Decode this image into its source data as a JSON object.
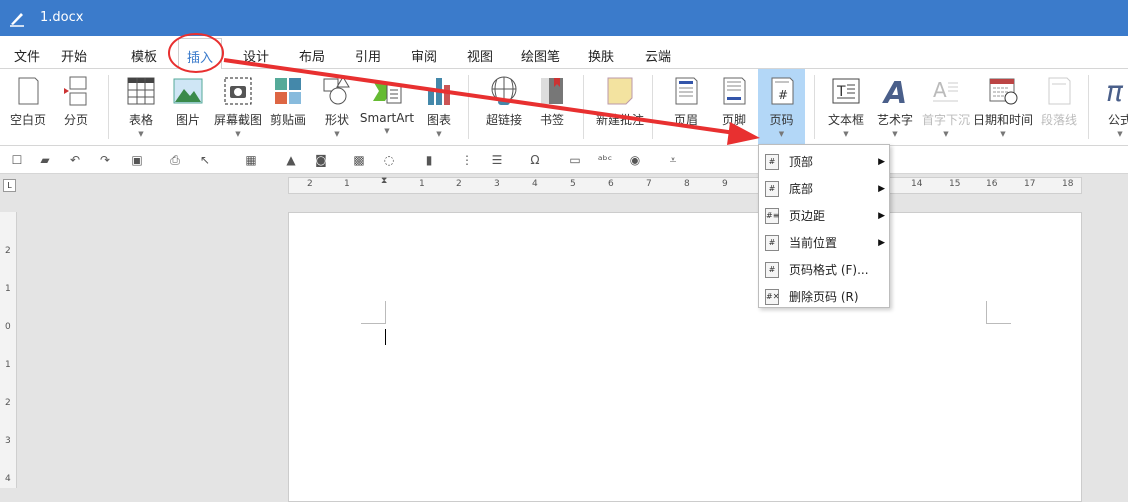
{
  "window": {
    "title": "1.docx"
  },
  "tabs": [
    {
      "label": "文件"
    },
    {
      "label": "开始"
    },
    {
      "label": "模板"
    },
    {
      "label": "插入"
    },
    {
      "label": "设计"
    },
    {
      "label": "布局"
    },
    {
      "label": "引用"
    },
    {
      "label": "审阅"
    },
    {
      "label": "视图"
    },
    {
      "label": "绘图笔"
    },
    {
      "label": "换肤"
    },
    {
      "label": "云端"
    }
  ],
  "active_tab": "插入",
  "ribbon": [
    {
      "label": "空白页",
      "icon": "blank-page-icon"
    },
    {
      "label": "分页",
      "icon": "page-break-icon"
    },
    {
      "label": "表格",
      "icon": "table-icon"
    },
    {
      "label": "图片",
      "icon": "picture-icon"
    },
    {
      "label": "屏幕截图",
      "icon": "screenshot-icon"
    },
    {
      "label": "剪贴画",
      "icon": "clipart-icon"
    },
    {
      "label": "形状",
      "icon": "shapes-icon"
    },
    {
      "label": "SmartArt",
      "icon": "smartart-icon"
    },
    {
      "label": "图表",
      "icon": "chart-icon"
    },
    {
      "label": "超链接",
      "icon": "hyperlink-icon"
    },
    {
      "label": "书签",
      "icon": "bookmark-icon"
    },
    {
      "label": "新建批注",
      "icon": "comment-icon"
    },
    {
      "label": "页眉",
      "icon": "header-icon"
    },
    {
      "label": "页脚",
      "icon": "footer-icon"
    },
    {
      "label": "页码",
      "icon": "page-number-icon"
    },
    {
      "label": "文本框",
      "icon": "textbox-icon"
    },
    {
      "label": "艺术字",
      "icon": "wordart-icon"
    },
    {
      "label": "首字下沉",
      "icon": "dropcap-icon"
    },
    {
      "label": "日期和时间",
      "icon": "datetime-icon"
    },
    {
      "label": "段落线",
      "icon": "paragraph-line-icon"
    },
    {
      "label": "公式",
      "icon": "equation-icon"
    }
  ],
  "menu": [
    {
      "label": "顶部",
      "glyph": "#",
      "submenu": true
    },
    {
      "label": "底部",
      "glyph": "#",
      "submenu": true
    },
    {
      "label": "页边距",
      "glyph": "#≡",
      "submenu": true
    },
    {
      "label": "当前位置",
      "glyph": "#",
      "submenu": true
    },
    {
      "label": "页码格式 (F)...",
      "glyph": "#",
      "submenu": false
    },
    {
      "label": "删除页码 (R)",
      "glyph": "#✕",
      "submenu": false
    }
  ],
  "ruler": {
    "h": [
      "2",
      "1",
      "1",
      "2",
      "3",
      "4",
      "5",
      "6",
      "7",
      "8",
      "9",
      "14",
      "15",
      "16",
      "17",
      "18"
    ],
    "v": [
      "2",
      "1",
      "0",
      "1",
      "2",
      "3",
      "4"
    ]
  },
  "annotation": {
    "color": "#e83030"
  }
}
